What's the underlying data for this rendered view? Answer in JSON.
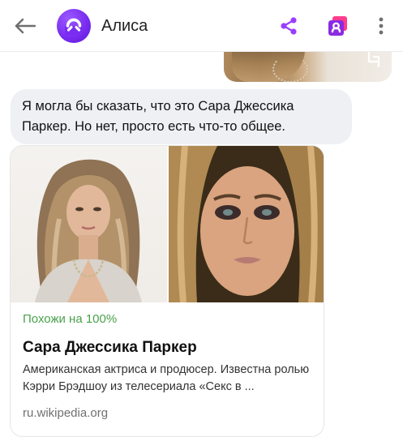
{
  "header": {
    "title": "Алиса",
    "back_icon": "arrow-left-icon",
    "share_icon": "share-icon",
    "cards_icon": "cards-icon",
    "menu_icon": "more-vertical-icon",
    "accent_color": "#9b3dff"
  },
  "chat": {
    "alice_message": "Я могла бы сказать, что это Сара Джессика Паркер. Но нет, просто есть что-то общее."
  },
  "result_card": {
    "similarity": "Похожи на 100%",
    "name": "Сара Джессика Паркер",
    "description": "Американская актриса и продюсер. Известна ролью Кэрри Брэдшоу из телесериала «Секс в ...",
    "source": "ru.wikipedia.org",
    "similarity_color": "#4aa14b"
  }
}
